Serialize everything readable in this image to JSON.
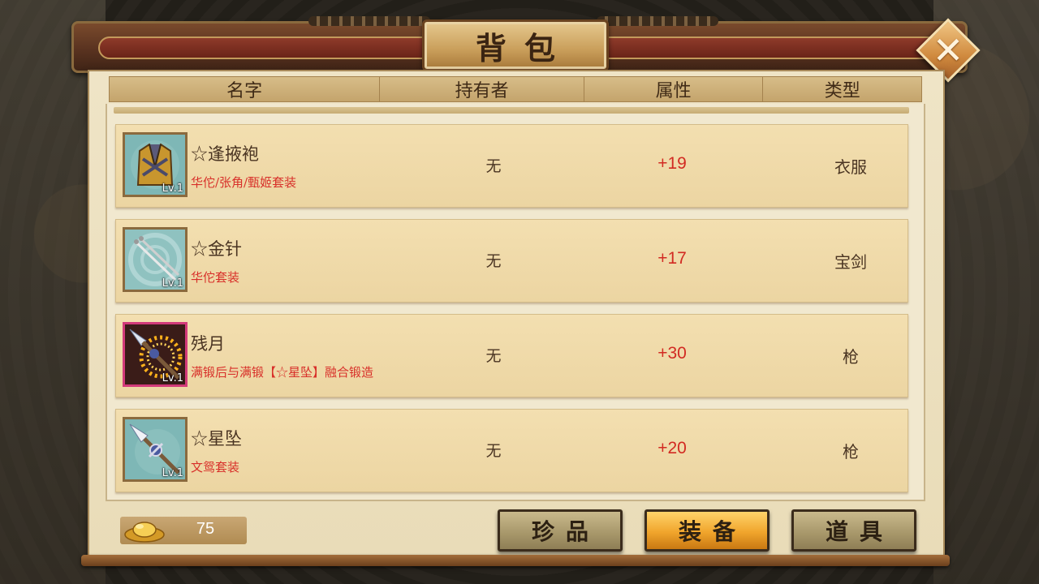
{
  "window": {
    "title": "背包",
    "close_icon": "close-x-icon"
  },
  "table": {
    "headers": [
      "名字",
      "持有者",
      "属性",
      "类型"
    ]
  },
  "items": [
    {
      "name": "☆逢掖袍",
      "set": "华佗/张角/甄姬套装",
      "level": "Lv.1",
      "owner": "无",
      "attribute": "+19",
      "type": "衣服",
      "icon": "robe-icon",
      "rarity": "normal"
    },
    {
      "name": "☆金针",
      "set": "华佗套装",
      "level": "Lv.1",
      "owner": "无",
      "attribute": "+17",
      "type": "宝剑",
      "icon": "needles-icon",
      "rarity": "normal"
    },
    {
      "name": "残月",
      "set": "满锻后与满锻【☆星坠】融合锻造",
      "level": "Lv.1",
      "owner": "无",
      "attribute": "+30",
      "type": "枪",
      "icon": "spear-glowing-icon",
      "rarity": "rare"
    },
    {
      "name": "☆星坠",
      "set": "文鸳套装",
      "level": "Lv.1",
      "owner": "无",
      "attribute": "+20",
      "type": "枪",
      "icon": "spear-icon",
      "rarity": "normal"
    }
  ],
  "currency": {
    "icon": "gold-ingot-icon",
    "value": "75"
  },
  "tabs": [
    {
      "label": "珍品",
      "active": false
    },
    {
      "label": "装备",
      "active": true
    },
    {
      "label": "道具",
      "active": false
    }
  ],
  "colors": {
    "attribute_red": "#d22a22",
    "active_tab": "#f0a52c",
    "rare_border": "#d23a7a"
  }
}
